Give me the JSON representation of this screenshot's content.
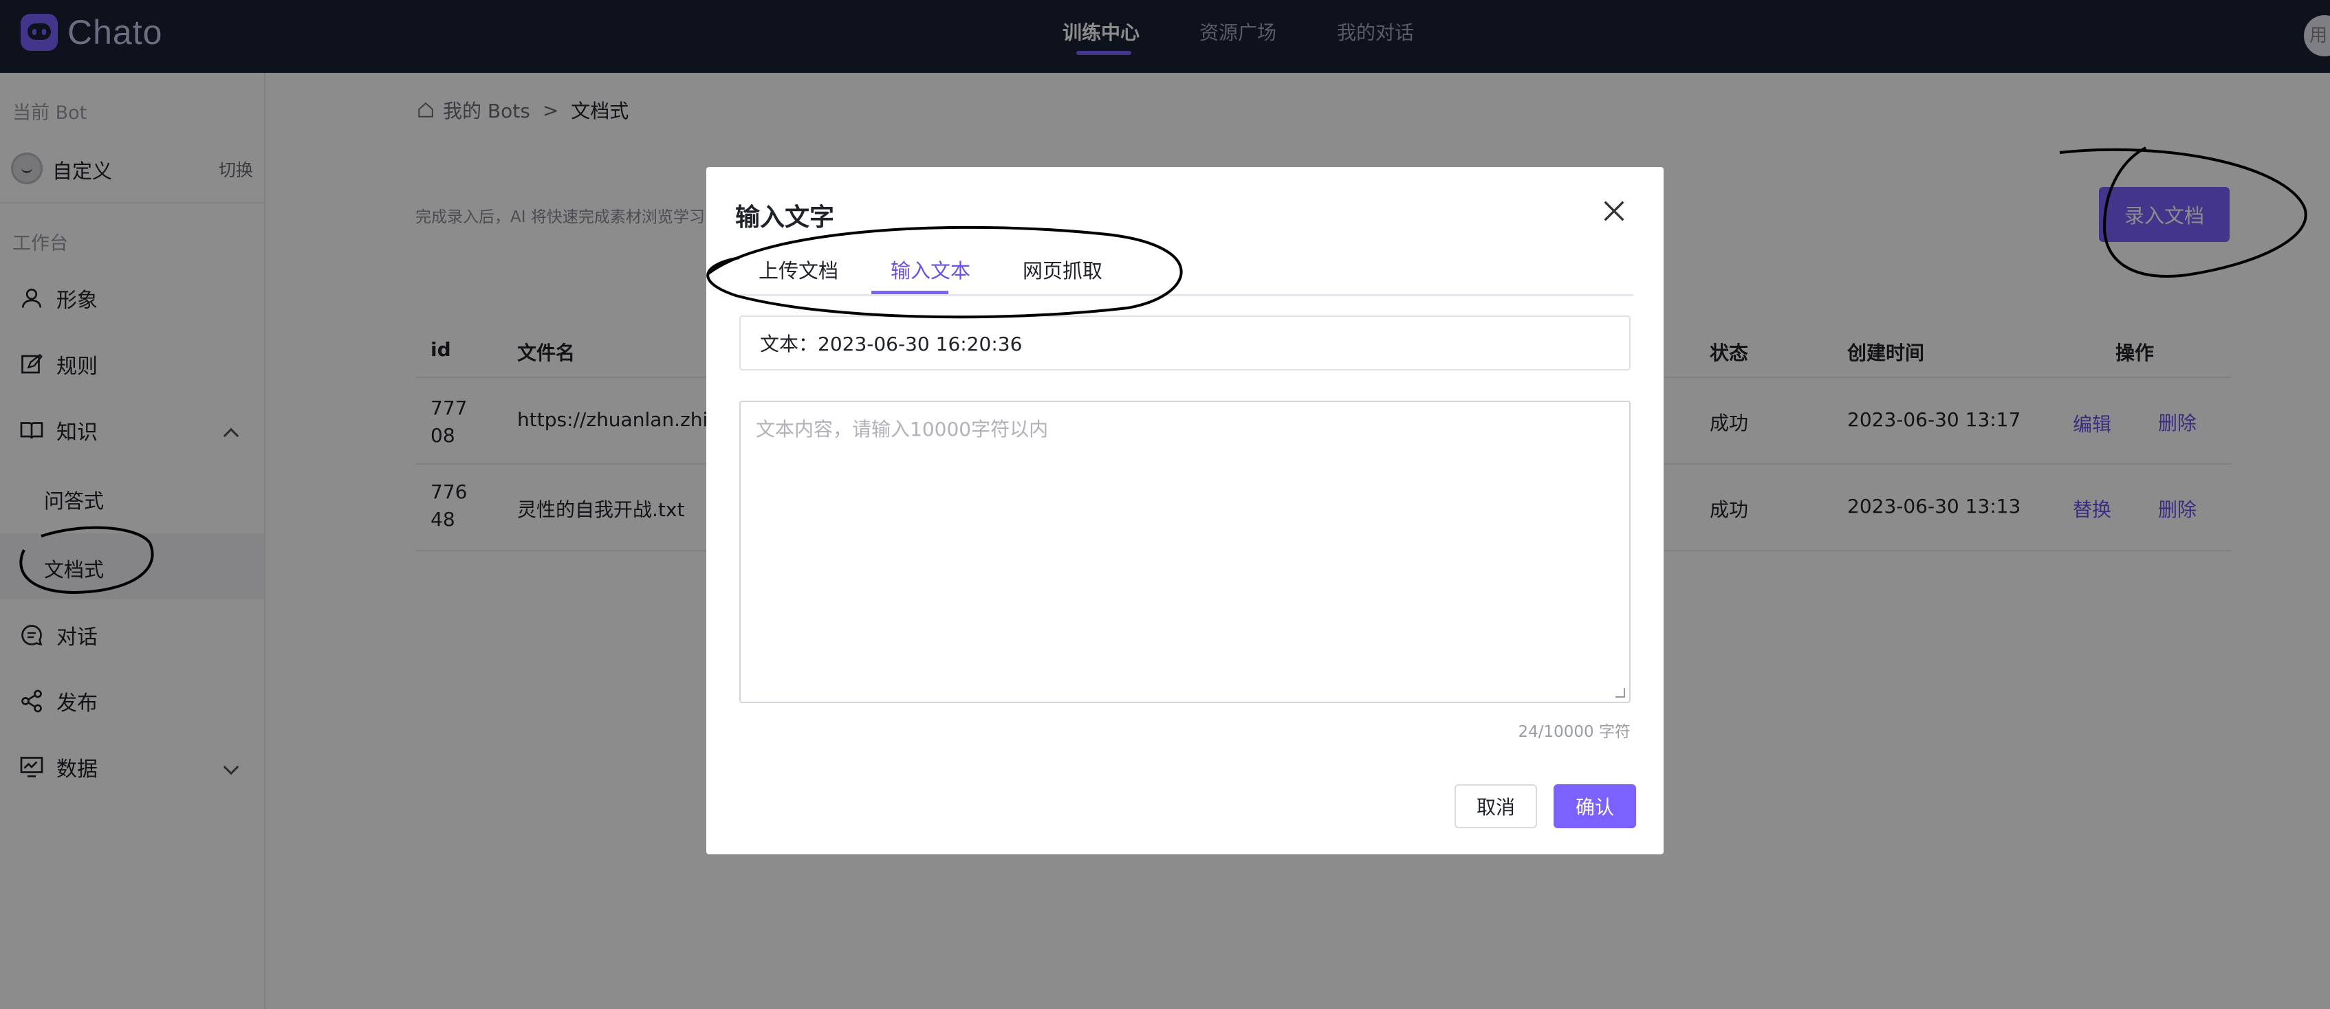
{
  "app": {
    "logo_text": "Chato"
  },
  "topnav": {
    "items": [
      "训练中心",
      "资源广场",
      "我的对话"
    ],
    "active": "训练中心",
    "avatar_text": "用"
  },
  "sidebar": {
    "current_bot_label": "当前 Bot",
    "bot_name": "自定义",
    "switch_label": "切换",
    "workbench_label": "工作台",
    "items": [
      "形象",
      "规则",
      "知识",
      "对话",
      "发布",
      "数据"
    ],
    "knowledge_sub": [
      "问答式",
      "文档式"
    ],
    "active_sub": "文档式"
  },
  "breadcrumb": {
    "root": "我的 Bots",
    "separator": ">",
    "current": "文档式"
  },
  "main": {
    "hint": "完成录入后，AI 将快速完成素材浏览学习",
    "add_doc_button": "录入文档",
    "table": {
      "headers": [
        "id",
        "文件名",
        "状态",
        "创建时间",
        "操作"
      ],
      "rows": [
        {
          "id": "77708",
          "filename": "https://zhuanlan.zhihu",
          "status": "成功",
          "created": "2023-06-30 13:17",
          "action1": "编辑",
          "action2": "删除"
        },
        {
          "id": "77648",
          "filename": "灵性的自我开战.txt",
          "status": "成功",
          "created": "2023-06-30 13:13",
          "action1": "替换",
          "action2": "删除"
        }
      ]
    }
  },
  "modal": {
    "title": "输入文字",
    "tabs": [
      "上传文档",
      "输入文本",
      "网页抓取"
    ],
    "active_tab": "输入文本",
    "title_value": "文本：2023-06-30 16:20:36",
    "textarea_placeholder": "文本内容，请输入10000字符以内",
    "counter": "24/10000 字符",
    "cancel": "取消",
    "confirm": "确认"
  },
  "colors": {
    "accent": "#7b61ff",
    "topbar": "#1b2236",
    "link": "#6a52e8"
  }
}
